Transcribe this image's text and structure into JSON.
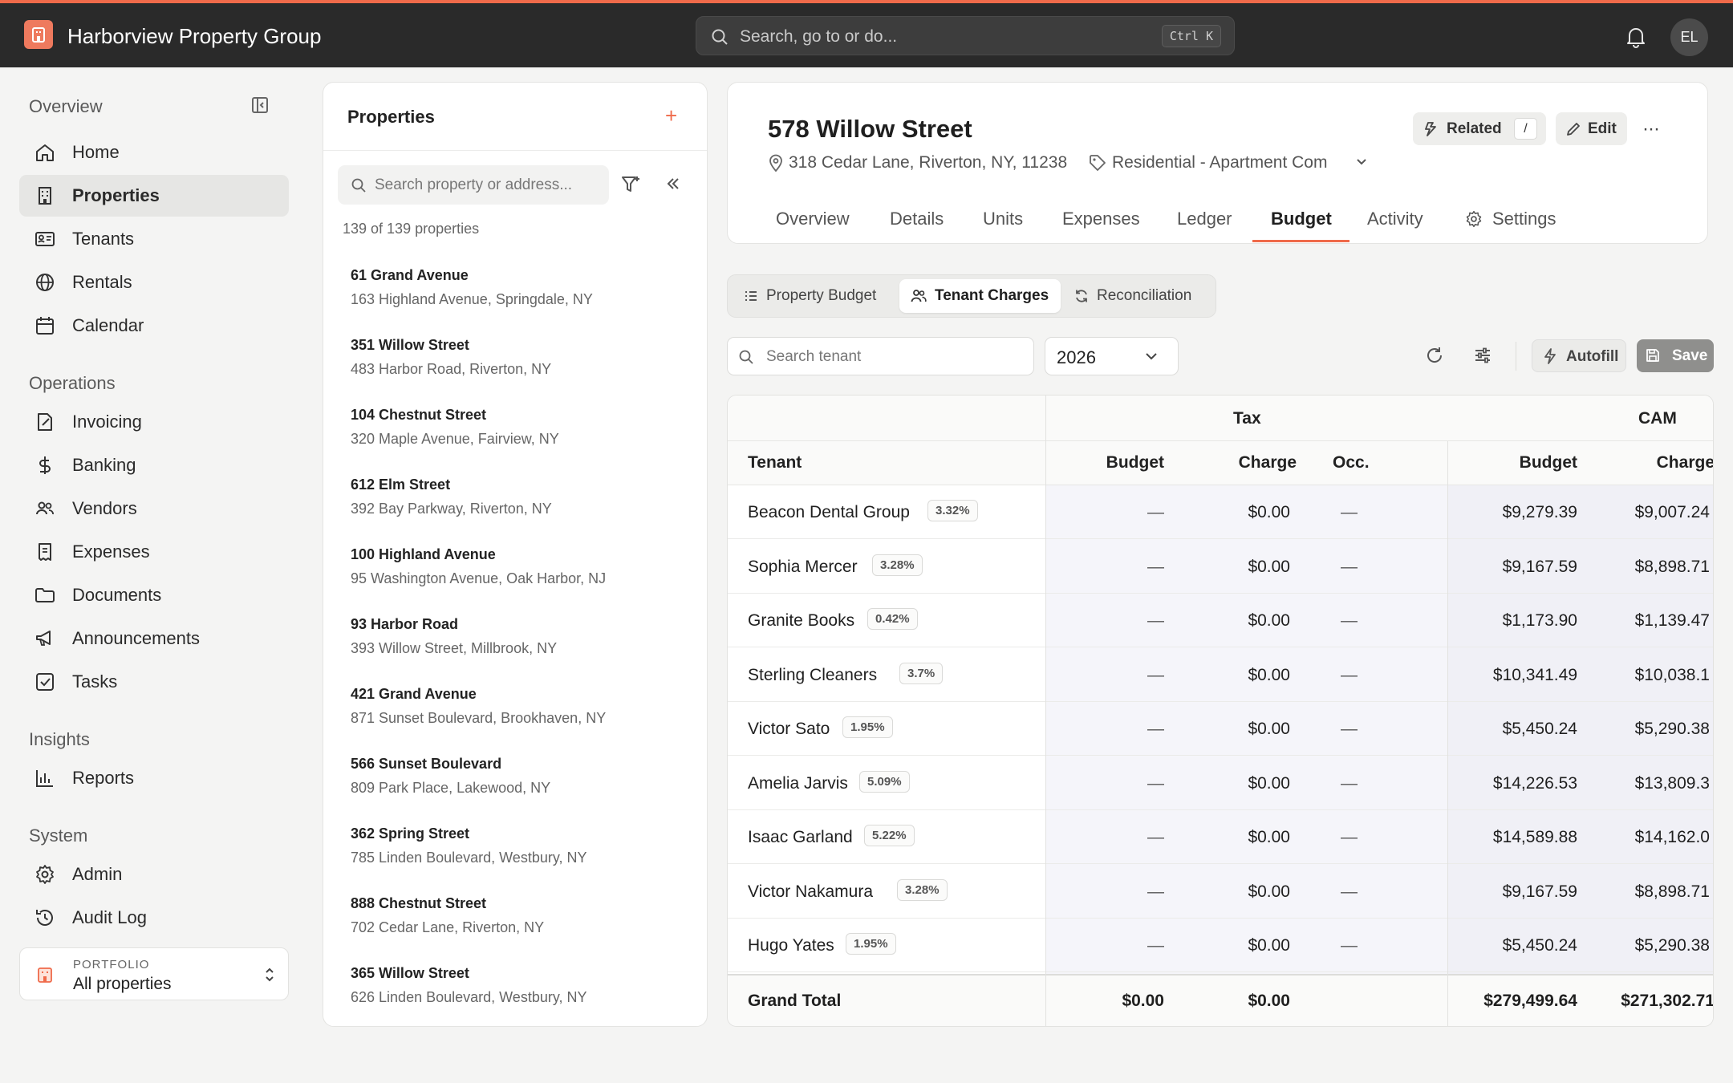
{
  "app": {
    "title": "Harborview Property Group",
    "search_placeholder": "Search, go to or do...",
    "search_shortcut": "Ctrl K",
    "user_initials": "EL",
    "accent_color": "#ef6a4a"
  },
  "sidebar": {
    "sections": [
      {
        "title": "Overview",
        "items": [
          {
            "label": "Home",
            "icon": "home-icon"
          },
          {
            "label": "Properties",
            "icon": "building-icon",
            "active": true
          },
          {
            "label": "Tenants",
            "icon": "id-card-icon"
          },
          {
            "label": "Rentals",
            "icon": "globe-icon"
          },
          {
            "label": "Calendar",
            "icon": "calendar-icon"
          }
        ]
      },
      {
        "title": "Operations",
        "items": [
          {
            "label": "Invoicing",
            "icon": "invoice-icon"
          },
          {
            "label": "Banking",
            "icon": "dollar-icon"
          },
          {
            "label": "Vendors",
            "icon": "users-icon"
          },
          {
            "label": "Expenses",
            "icon": "receipt-icon"
          },
          {
            "label": "Documents",
            "icon": "folder-icon"
          },
          {
            "label": "Announcements",
            "icon": "megaphone-icon"
          },
          {
            "label": "Tasks",
            "icon": "checkbox-icon"
          }
        ]
      },
      {
        "title": "Insights",
        "items": [
          {
            "label": "Reports",
            "icon": "bar-chart-icon"
          }
        ]
      },
      {
        "title": "System",
        "items": [
          {
            "label": "Admin",
            "icon": "gear-icon"
          },
          {
            "label": "Audit Log",
            "icon": "history-icon"
          }
        ]
      }
    ],
    "portfolio": {
      "label": "PORTFOLIO",
      "value": "All properties"
    }
  },
  "properties_panel": {
    "title": "Properties",
    "search_placeholder": "Search property or address...",
    "count_text": "139 of 139 properties",
    "items": [
      {
        "name": "61 Grand Avenue",
        "address": "163 Highland Avenue, Springdale, NY"
      },
      {
        "name": "351 Willow Street",
        "address": "483 Harbor Road, Riverton, NY"
      },
      {
        "name": "104 Chestnut Street",
        "address": "320 Maple Avenue, Fairview, NY"
      },
      {
        "name": "612 Elm Street",
        "address": "392 Bay Parkway, Riverton, NY"
      },
      {
        "name": "100 Highland Avenue",
        "address": "95 Washington Avenue, Oak Harbor, NJ"
      },
      {
        "name": "93 Harbor Road",
        "address": "393 Willow Street, Millbrook, NY"
      },
      {
        "name": "421 Grand Avenue",
        "address": "871 Sunset Boulevard, Brookhaven, NY"
      },
      {
        "name": "566 Sunset Boulevard",
        "address": "809 Park Place, Lakewood, NY"
      },
      {
        "name": "362 Spring Street",
        "address": "785 Linden Boulevard, Westbury, NY"
      },
      {
        "name": "888 Chestnut Street",
        "address": "702 Cedar Lane, Riverton, NY"
      },
      {
        "name": "365 Willow Street",
        "address": "626 Linden Boulevard, Westbury, NY"
      }
    ]
  },
  "property": {
    "title": "578 Willow Street",
    "address": "318 Cedar Lane, Riverton, NY, 11238",
    "type": "Residential - Apartment Com",
    "related_label": "Related",
    "related_shortcut": "/",
    "edit_label": "Edit",
    "tabs": [
      "Overview",
      "Details",
      "Units",
      "Expenses",
      "Ledger",
      "Budget",
      "Activity",
      "Settings"
    ],
    "active_tab": "Budget"
  },
  "budget": {
    "segments": [
      "Property Budget",
      "Tenant Charges",
      "Reconciliation"
    ],
    "active_segment": "Tenant Charges",
    "tenant_search_placeholder": "Search tenant",
    "year": "2026",
    "autofill_label": "Autofill",
    "save_label": "Save"
  },
  "table": {
    "group_headers": {
      "tax": "Tax",
      "cam": "CAM"
    },
    "columns": {
      "tenant": "Tenant",
      "tax_budget": "Budget",
      "tax_charge": "Charge",
      "occ": "Occ.",
      "cam_budget": "Budget",
      "cam_charge": "Charge"
    },
    "rows": [
      {
        "tenant": "Beacon Dental Group",
        "pct": "3.32%",
        "tax_budget": "—",
        "tax_charge": "$0.00",
        "occ": "—",
        "cam_budget": "$9,279.39",
        "cam_charge": "$9,007.24"
      },
      {
        "tenant": "Sophia Mercer",
        "pct": "3.28%",
        "tax_budget": "—",
        "tax_charge": "$0.00",
        "occ": "—",
        "cam_budget": "$9,167.59",
        "cam_charge": "$8,898.71"
      },
      {
        "tenant": "Granite Books",
        "pct": "0.42%",
        "tax_budget": "—",
        "tax_charge": "$0.00",
        "occ": "—",
        "cam_budget": "$1,173.90",
        "cam_charge": "$1,139.47"
      },
      {
        "tenant": "Sterling Cleaners",
        "pct": "3.7%",
        "tax_budget": "—",
        "tax_charge": "$0.00",
        "occ": "—",
        "cam_budget": "$10,341.49",
        "cam_charge": "$10,038.1"
      },
      {
        "tenant": "Victor Sato",
        "pct": "1.95%",
        "tax_budget": "—",
        "tax_charge": "$0.00",
        "occ": "—",
        "cam_budget": "$5,450.24",
        "cam_charge": "$5,290.38"
      },
      {
        "tenant": "Amelia Jarvis",
        "pct": "5.09%",
        "tax_budget": "—",
        "tax_charge": "$0.00",
        "occ": "—",
        "cam_budget": "$14,226.53",
        "cam_charge": "$13,809.3"
      },
      {
        "tenant": "Isaac Garland",
        "pct": "5.22%",
        "tax_budget": "—",
        "tax_charge": "$0.00",
        "occ": "—",
        "cam_budget": "$14,589.88",
        "cam_charge": "$14,162.0"
      },
      {
        "tenant": "Victor Nakamura",
        "pct": "3.28%",
        "tax_budget": "—",
        "tax_charge": "$0.00",
        "occ": "—",
        "cam_budget": "$9,167.59",
        "cam_charge": "$8,898.71"
      },
      {
        "tenant": "Hugo Yates",
        "pct": "1.95%",
        "tax_budget": "—",
        "tax_charge": "$0.00",
        "occ": "—",
        "cam_budget": "$5,450.24",
        "cam_charge": "$5,290.38"
      }
    ],
    "total": {
      "label": "Grand Total",
      "tax_budget": "$0.00",
      "tax_charge": "$0.00",
      "cam_budget": "$279,499.64",
      "cam_charge": "$271,302.71"
    }
  }
}
